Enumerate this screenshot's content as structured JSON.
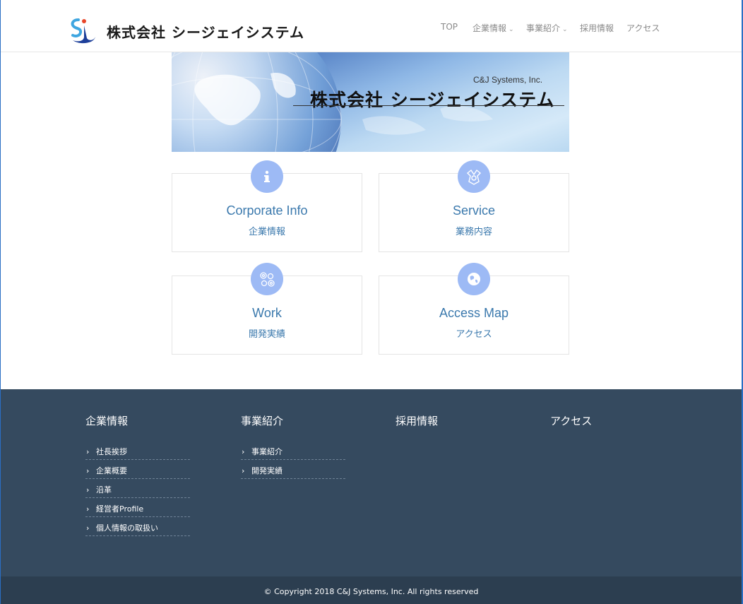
{
  "header": {
    "logo_text": "株式会社 シージェイシステム",
    "nav": [
      {
        "label": "TOP",
        "has_caret": false
      },
      {
        "label": "企業情報",
        "has_caret": true
      },
      {
        "label": "事業紹介",
        "has_caret": true
      },
      {
        "label": "採用情報",
        "has_caret": false
      },
      {
        "label": "アクセス",
        "has_caret": false
      }
    ]
  },
  "banner": {
    "company_en": "C&J Systems, Inc.",
    "company_jp": "株式会社 シージェイシステム"
  },
  "cards": [
    {
      "title": "Corporate Info",
      "subtitle": "企業情報",
      "icon": "info-icon"
    },
    {
      "title": "Service",
      "subtitle": "業務内容",
      "icon": "service-icon"
    },
    {
      "title": "Work",
      "subtitle": "開発実績",
      "icon": "gears-icon"
    },
    {
      "title": "Access Map",
      "subtitle": "アクセス",
      "icon": "globe-icon"
    }
  ],
  "footer": {
    "columns": [
      {
        "heading": "企業情報",
        "items": [
          "社長挨拶",
          "企業概要",
          "沿革",
          "経営者Profile",
          "個人情報の取扱い"
        ]
      },
      {
        "heading": "事業紹介",
        "items": [
          "事業紹介",
          "開発実績"
        ]
      },
      {
        "heading": "採用情報",
        "items": []
      },
      {
        "heading": "アクセス",
        "items": []
      }
    ],
    "copyright": "© Copyright 2018 C&J Systems, Inc. All rights reserved"
  },
  "colors": {
    "accent_text": "#3b79ad",
    "icon_circle": "#9dbaf5",
    "footer_bg": "#354a5f",
    "copyright_bg": "#2c3e50"
  }
}
